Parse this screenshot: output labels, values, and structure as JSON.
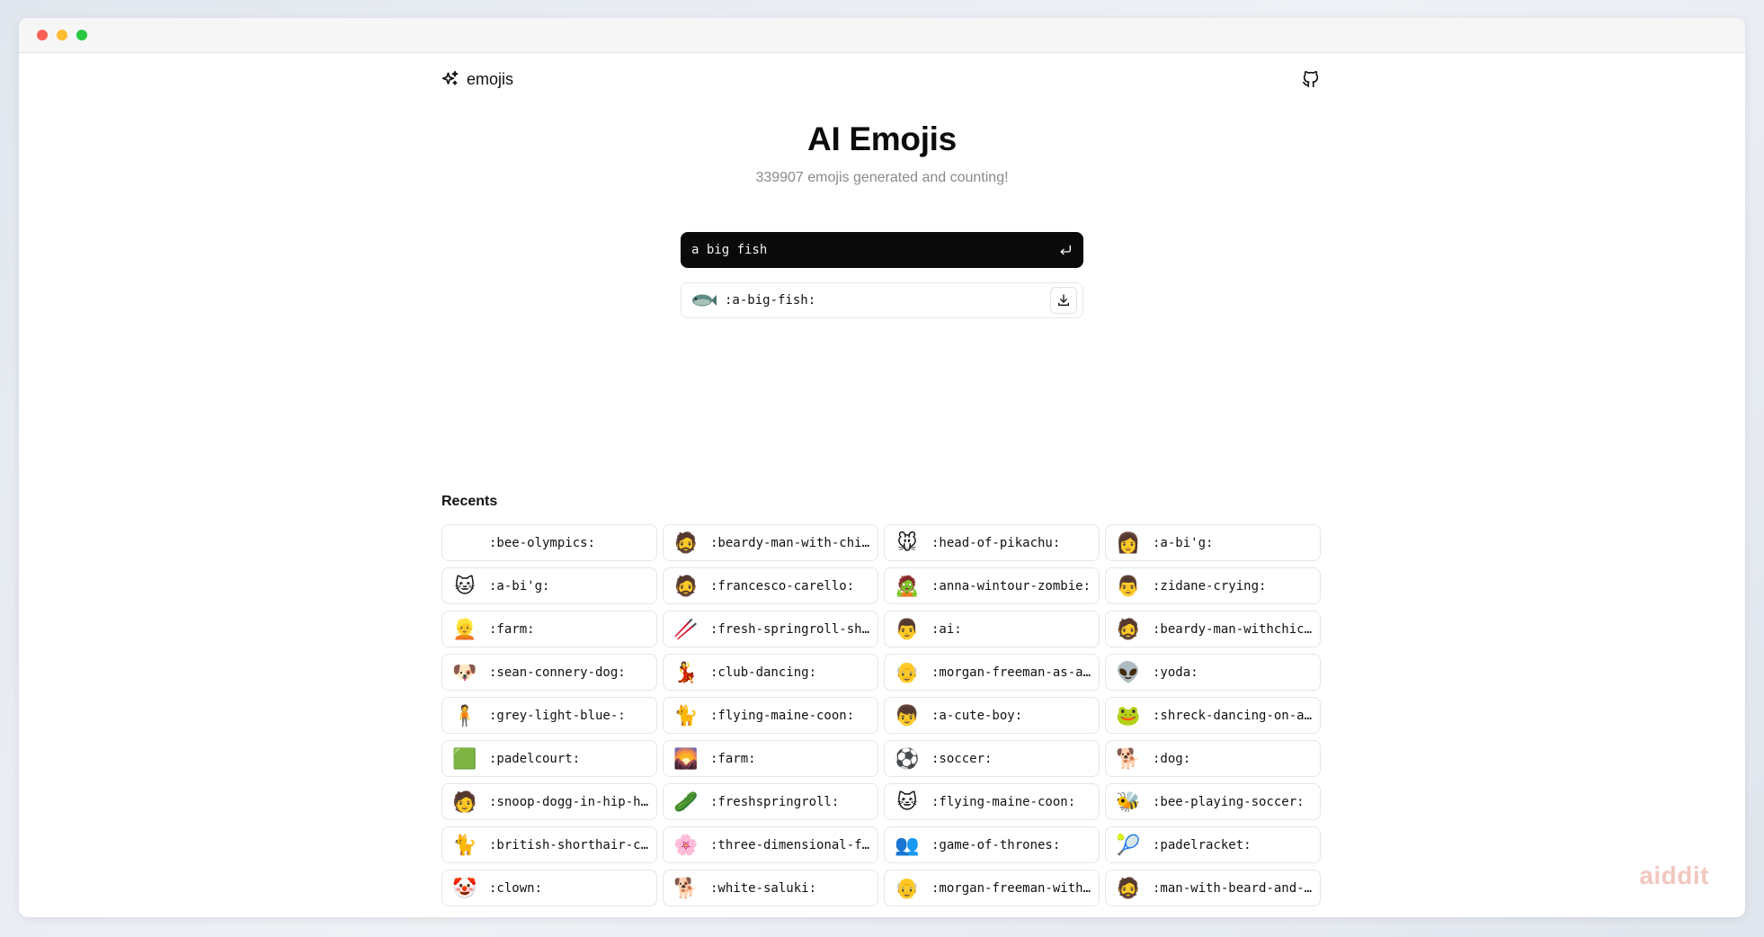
{
  "nav": {
    "brand": "emojis",
    "brand_icon": "sparkles-icon",
    "github_icon": "github-icon"
  },
  "hero": {
    "title": "AI Emojis",
    "subtitle": "339907 emojis generated and counting!"
  },
  "search": {
    "value": "a big fish",
    "placeholder": "",
    "submit_icon": "enter-icon"
  },
  "result": {
    "code": ":a-big-fish:",
    "icon": "fish",
    "download_icon": "download-icon"
  },
  "recents": {
    "title": "Recents",
    "items": [
      {
        "code": ":bee-olympics:",
        "icon": ""
      },
      {
        "code": ":beardy-man-with-chic…",
        "icon": "🧔"
      },
      {
        "code": ":head-of-pikachu:",
        "icon": "🐭"
      },
      {
        "code": ":a-bi'g:",
        "icon": "👩"
      },
      {
        "code": ":a-bi'g:",
        "icon": "🐱"
      },
      {
        "code": ":francesco-carello:",
        "icon": "🧔"
      },
      {
        "code": ":anna-wintour-zombie:",
        "icon": "🧟"
      },
      {
        "code": ":zidane-crying:",
        "icon": "👨"
      },
      {
        "code": ":farm:",
        "icon": "👱"
      },
      {
        "code": ":fresh-springroll-shr…",
        "icon": "🥢"
      },
      {
        "code": ":ai:",
        "icon": "👨"
      },
      {
        "code": ":beardy-man-withchick…",
        "icon": "🧔"
      },
      {
        "code": ":sean-connery-dog:",
        "icon": "🐶"
      },
      {
        "code": ":club-dancing:",
        "icon": "💃"
      },
      {
        "code": ":morgan-freeman-as-an…",
        "icon": "👴"
      },
      {
        "code": ":yoda:",
        "icon": "👽"
      },
      {
        "code": ":grey-light-blue-:",
        "icon": "🧍"
      },
      {
        "code": ":flying-maine-coon:",
        "icon": "🐈"
      },
      {
        "code": ":a-cute-boy:",
        "icon": "👦"
      },
      {
        "code": ":shreck-dancing-on-a-…",
        "icon": "🐸"
      },
      {
        "code": ":padelcourt:",
        "icon": "🟩"
      },
      {
        "code": ":farm:",
        "icon": "🌄"
      },
      {
        "code": ":soccer:",
        "icon": "⚽"
      },
      {
        "code": ":dog:",
        "icon": "🐕"
      },
      {
        "code": ":snoop-dogg-in-hip-ho…",
        "icon": "🧑"
      },
      {
        "code": ":freshspringroll:",
        "icon": "🥒"
      },
      {
        "code": ":flying-maine-coon:",
        "icon": "🐱"
      },
      {
        "code": ":bee-playing-soccer:",
        "icon": "🐝"
      },
      {
        "code": ":british-shorthair-ca…",
        "icon": "🐈"
      },
      {
        "code": ":three-dimensional-fl…",
        "icon": "🌸"
      },
      {
        "code": ":game-of-thrones:",
        "icon": "👥"
      },
      {
        "code": ":padelracket:",
        "icon": "🎾"
      },
      {
        "code": ":clown:",
        "icon": "🤡"
      },
      {
        "code": ":white-saluki:",
        "icon": "🐕"
      },
      {
        "code": ":morgan-freeman-with-…",
        "icon": "👴"
      },
      {
        "code": ":man-with-beard-and-a…",
        "icon": "🧔"
      }
    ]
  },
  "watermark": "aiddit",
  "colors": {
    "search_bg": "#0a0a0a",
    "card_border": "#e6e6e6",
    "subtitle": "#8a8a8a",
    "traffic_red": "#fe5f57",
    "traffic_yellow": "#febc2e",
    "traffic_green": "#28c840"
  }
}
